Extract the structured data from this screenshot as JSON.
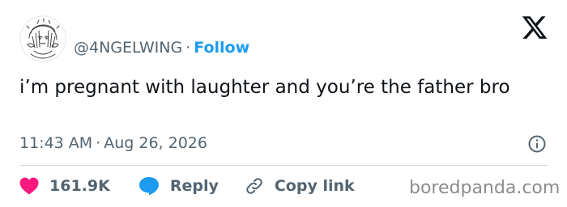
{
  "tweet": {
    "handle": "@4NGELWING",
    "separator": "·",
    "follow_label": "Follow",
    "text": "i’m pregnant with laughter and you’re the father bro",
    "time": "11:43 AM",
    "date": "Aug 26, 2026"
  },
  "actions": {
    "like_count": "161.9K",
    "reply_label": "Reply",
    "copy_link_label": "Copy link"
  },
  "icons": {
    "logo": "x-logo-icon",
    "info": "info-icon",
    "like": "heart-icon",
    "reply": "speech-bubble-icon",
    "copy": "link-icon"
  },
  "colors": {
    "accent": "#1d9bf0",
    "like": "#f91880",
    "muted": "#536471",
    "text": "#0f1419"
  },
  "watermark": "boredpanda.com"
}
